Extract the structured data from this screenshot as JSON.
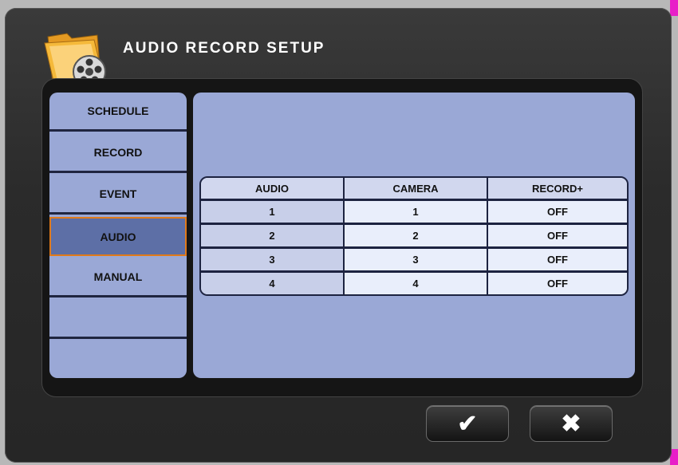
{
  "dialog": {
    "title": "AUDIO RECORD SETUP",
    "icon": "folder-film-reel-icon"
  },
  "sidebar": {
    "items": [
      {
        "label": "SCHEDULE",
        "active": false
      },
      {
        "label": "RECORD",
        "active": false
      },
      {
        "label": "EVENT",
        "active": false
      },
      {
        "label": "AUDIO",
        "active": true
      },
      {
        "label": "MANUAL",
        "active": false
      },
      {
        "label": "",
        "active": false
      },
      {
        "label": "",
        "active": false
      }
    ]
  },
  "table": {
    "headers": [
      "AUDIO",
      "CAMERA",
      "RECORD+"
    ],
    "rows": [
      {
        "audio": "1",
        "camera": "1",
        "record": "OFF"
      },
      {
        "audio": "2",
        "camera": "2",
        "record": "OFF"
      },
      {
        "audio": "3",
        "camera": "3",
        "record": "OFF"
      },
      {
        "audio": "4",
        "camera": "4",
        "record": "OFF"
      }
    ]
  },
  "buttons": {
    "confirm": {
      "glyph": "✔",
      "icon": "checkmark-icon"
    },
    "cancel": {
      "glyph": "✖",
      "icon": "close-icon"
    }
  },
  "colors": {
    "panel_bg": "#9aa8d6",
    "active_item": "#5d6fa6",
    "active_border": "#e07a1a"
  }
}
